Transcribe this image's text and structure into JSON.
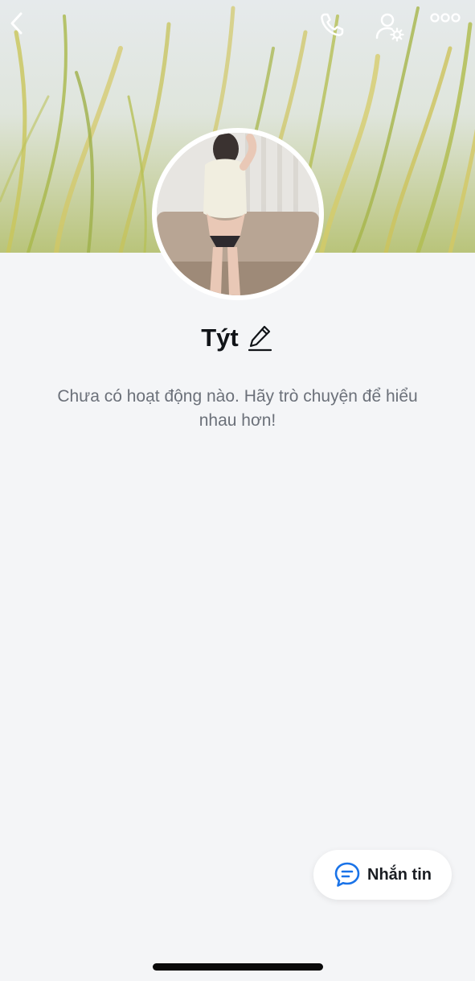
{
  "profile": {
    "name": "Týt",
    "empty_activity_message": "Chưa có hoạt động nào. Hãy trò chuyện để hiểu nhau hơn!"
  },
  "actions": {
    "message_label": "Nhắn tin"
  },
  "icons": {
    "back": "chevron-left-icon",
    "call": "phone-icon",
    "profile_settings": "user-gear-icon",
    "more": "more-dots-icon",
    "edit": "pencil-icon",
    "message": "chat-bubble-icon"
  },
  "colors": {
    "background": "#f4f5f7",
    "accent": "#1a73e8",
    "icon_on_cover": "#ffffff"
  }
}
